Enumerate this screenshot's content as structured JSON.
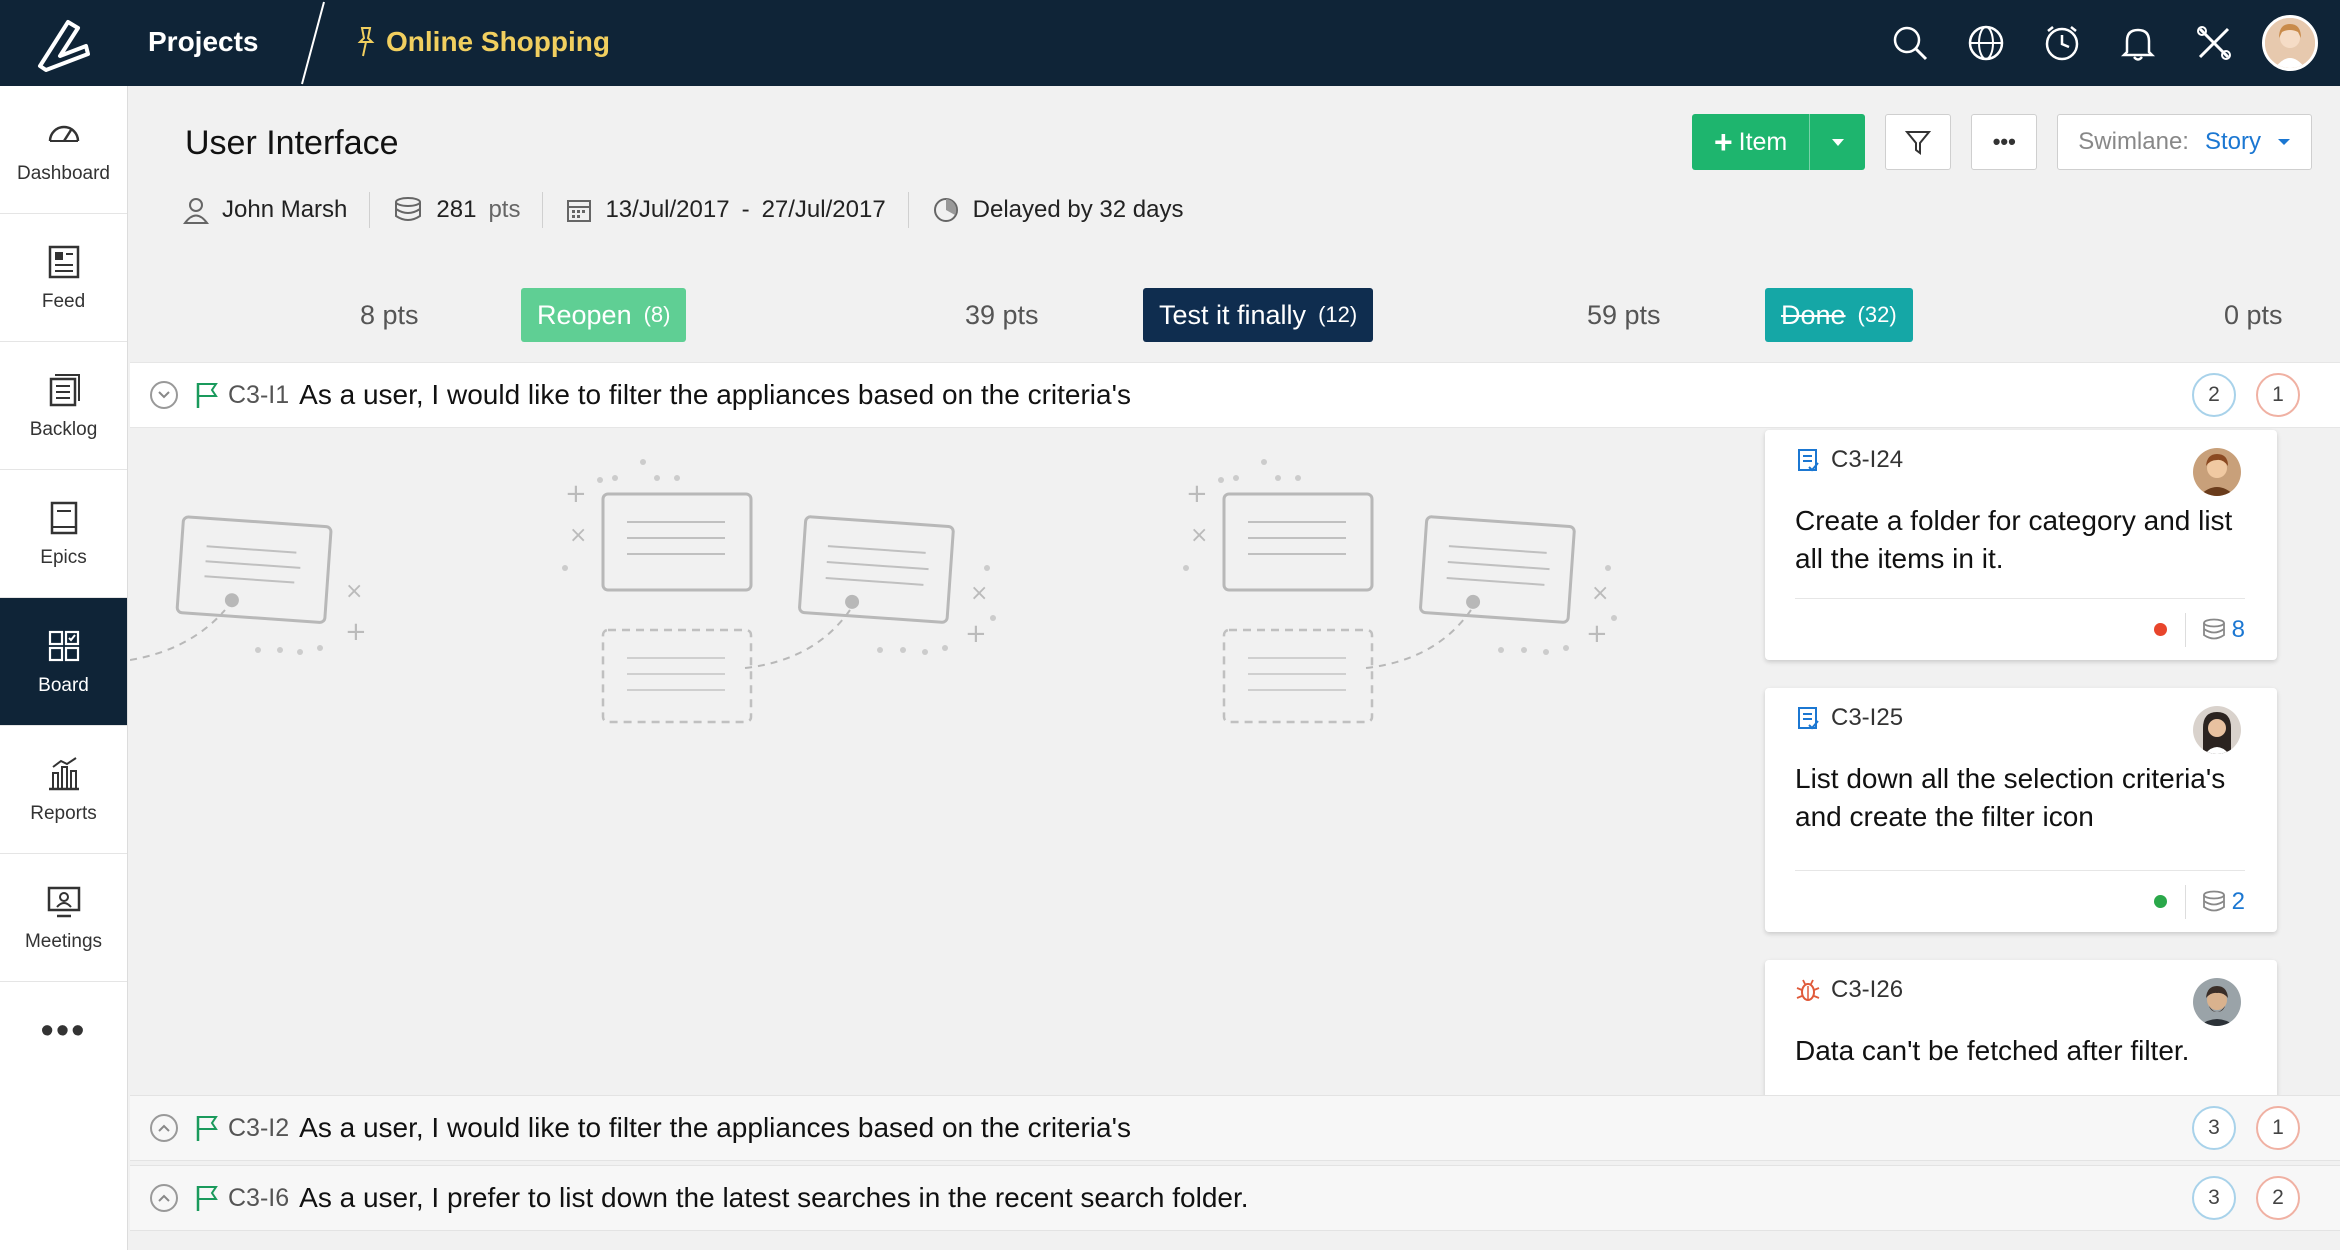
{
  "topbar": {
    "projects_label": "Projects",
    "project_name": "Online Shopping",
    "icons": [
      "search-icon",
      "globe-icon",
      "clock-icon",
      "bell-icon",
      "tools-icon"
    ]
  },
  "sidebar": {
    "items": [
      {
        "label": "Dashboard",
        "icon": "dashboard-icon"
      },
      {
        "label": "Feed",
        "icon": "feed-icon"
      },
      {
        "label": "Backlog",
        "icon": "backlog-icon"
      },
      {
        "label": "Epics",
        "icon": "epics-icon"
      },
      {
        "label": "Board",
        "icon": "board-icon",
        "active": true
      },
      {
        "label": "Reports",
        "icon": "reports-icon"
      },
      {
        "label": "Meetings",
        "icon": "meetings-icon"
      }
    ],
    "more": "•••"
  },
  "header": {
    "title": "User Interface",
    "owner": "John Marsh",
    "points": "281",
    "points_unit": "pts",
    "start_date": "13/Jul/2017",
    "date_sep": "-",
    "end_date": "27/Jul/2017",
    "delay": "Delayed by 32 days"
  },
  "actions": {
    "add_item_label": "Item",
    "swimlane_label": "Swimlane:",
    "swimlane_value": "Story",
    "more": "•••"
  },
  "columns": [
    {
      "pts": "8 pts",
      "status": "Reopen",
      "count": "(8)",
      "color": "#5fcf94"
    },
    {
      "pts": "39 pts",
      "status": "Test it finally",
      "count": "(12)",
      "color": "#0f2d4f"
    },
    {
      "pts": "59 pts",
      "status": "Done",
      "count": "(32)",
      "color": "#15a7a6"
    },
    {
      "pts": "0 pts"
    }
  ],
  "lanes": [
    {
      "id": "C3-I1",
      "title": "As a user, I would like to filter the appliances based on the criteria's",
      "count_a": "2",
      "count_b": "1"
    },
    {
      "id": "C3-I2",
      "title": "As a user, I would like to filter the appliances based on the criteria's",
      "count_a": "3",
      "count_b": "1"
    },
    {
      "id": "C3-I6",
      "title": "As a user, I prefer to list down the latest searches in the recent search folder.",
      "count_a": "3",
      "count_b": "2"
    }
  ],
  "cards": [
    {
      "id": "C3-I24",
      "title": "Create a folder for category and list all the items in it.",
      "points": "8",
      "status_color": "#e8452c",
      "type": "task"
    },
    {
      "id": "C3-I25",
      "title": "List down all the selection criteria's and create the filter icon",
      "points": "2",
      "status_color": "#2aa84a",
      "type": "task"
    },
    {
      "id": "C3-I26",
      "title": "Data can't be fetched after filter.",
      "type": "bug"
    }
  ],
  "colors": {
    "topbar": "#0f2437",
    "accent_green": "#1eb56e",
    "link_blue": "#1b77d2",
    "project_yellow": "#f1cf5f"
  }
}
